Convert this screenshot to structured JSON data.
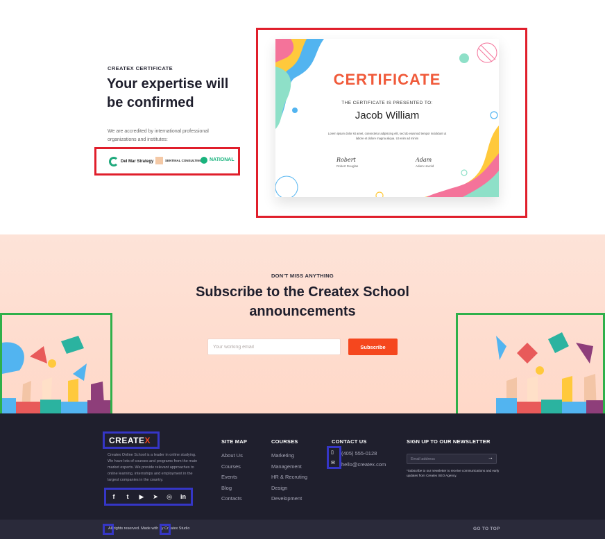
{
  "certificate_section": {
    "eyebrow": "CREATEX CERTIFICATE",
    "heading": "Your expertise will be confirmed",
    "description": "We are accredited by international professional organizations and institutes:",
    "partners": [
      {
        "name": "Del Mar Strategy",
        "icon": "del-mar-logo"
      },
      {
        "name": "SENTINAL CONSULTING",
        "icon": "sentinal-logo"
      },
      {
        "name": "NATIONAL",
        "icon": "national-logo"
      }
    ],
    "card": {
      "title": "CERTIFICATE",
      "presented_to": "THE CERTIFICATE IS PRESENTED TO:",
      "recipient": "Jacob William",
      "body": "Lorem ipsum dolor sit amet, consectetur adipiscing elit, sed do eiusmod tempor incididunt ut labore et dolore magna aliqua. Ut enim ad minim",
      "signatures": [
        {
          "script": "Robert",
          "name": "Robert Douglas"
        },
        {
          "script": "Adam",
          "name": "Adam Harold"
        }
      ]
    }
  },
  "subscribe": {
    "eyebrow": "DON'T MISS ANYTHING",
    "heading": "Subscribe to the Createx School announcements",
    "email_placeholder": "Your working email",
    "button_label": "Subscribe"
  },
  "footer": {
    "logo_text": "CREATE",
    "logo_accent": "X",
    "about": "Createx Online School is a leader in online studying. We have lots of courses and programs from the main market experts. We provide relevant approaches to online learning, internships and employment in the largest companies in the country.",
    "social": [
      "f",
      "t",
      "▶",
      "➤",
      "◎",
      "in"
    ],
    "sitemap": {
      "heading": "SITE MAP",
      "links": [
        "About Us",
        "Courses",
        "Events",
        "Blog",
        "Contacts"
      ]
    },
    "courses": {
      "heading": "COURSES",
      "links": [
        "Marketing",
        "Management",
        "HR & Recruting",
        "Design",
        "Development"
      ]
    },
    "contact": {
      "heading": "CONTACT US",
      "phone": "(405) 555-0128",
      "email": "hello@createx.com"
    },
    "newsletter": {
      "heading": "SIGN UP TO OUR NEWSLETTER",
      "placeholder": "Email address",
      "note": "*Subscribe to our newsletter to receive communications and early updates from Createx SEO Agency."
    },
    "copyright": "All rights reserved. Made with    by Createx Studio",
    "go_to_top": "GO TO TOP"
  },
  "colors": {
    "accent": "#f5471e",
    "annotation_red": "#e01e2b",
    "annotation_green": "#2fb04a",
    "annotation_blue": "#3536c6",
    "footer_bg": "#1f1f2d"
  }
}
